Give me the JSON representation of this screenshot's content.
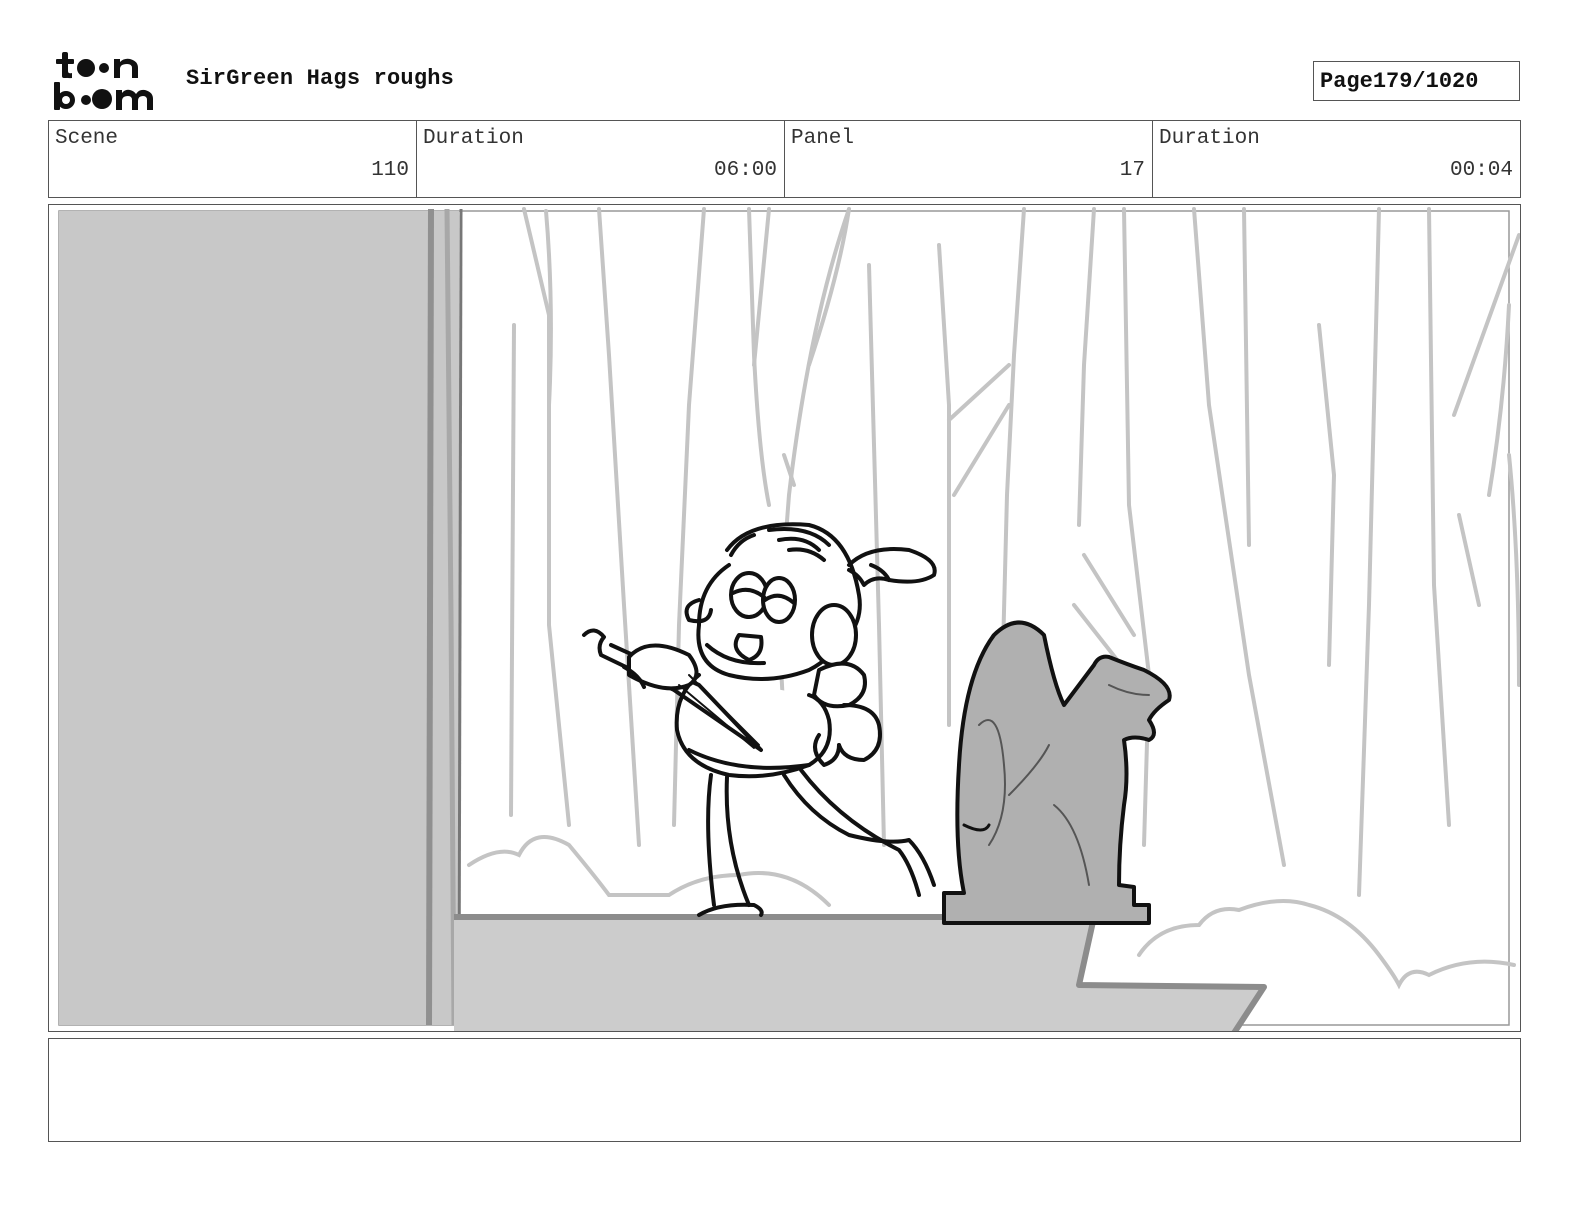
{
  "header": {
    "logo_text_top": "toon",
    "logo_text_bottom": "boom",
    "project_title": "SirGreen Hags roughs",
    "page_label": "Page",
    "page_value": "179/1020"
  },
  "info": [
    {
      "label": "Scene",
      "value": "110"
    },
    {
      "label": "Duration",
      "value": "06:00"
    },
    {
      "label": "Panel",
      "value": "17"
    },
    {
      "label": "Duration",
      "value": "00:04"
    }
  ],
  "panel": {
    "drawing": "storyboard-sketch",
    "colors": {
      "background_lines": "#c4c4c4",
      "wall_fill": "#c8c8c8",
      "ledge_fill": "#cccccc",
      "statue_fill": "#b0b0b0",
      "ink": "#111111"
    }
  },
  "notes": {
    "text": ""
  }
}
